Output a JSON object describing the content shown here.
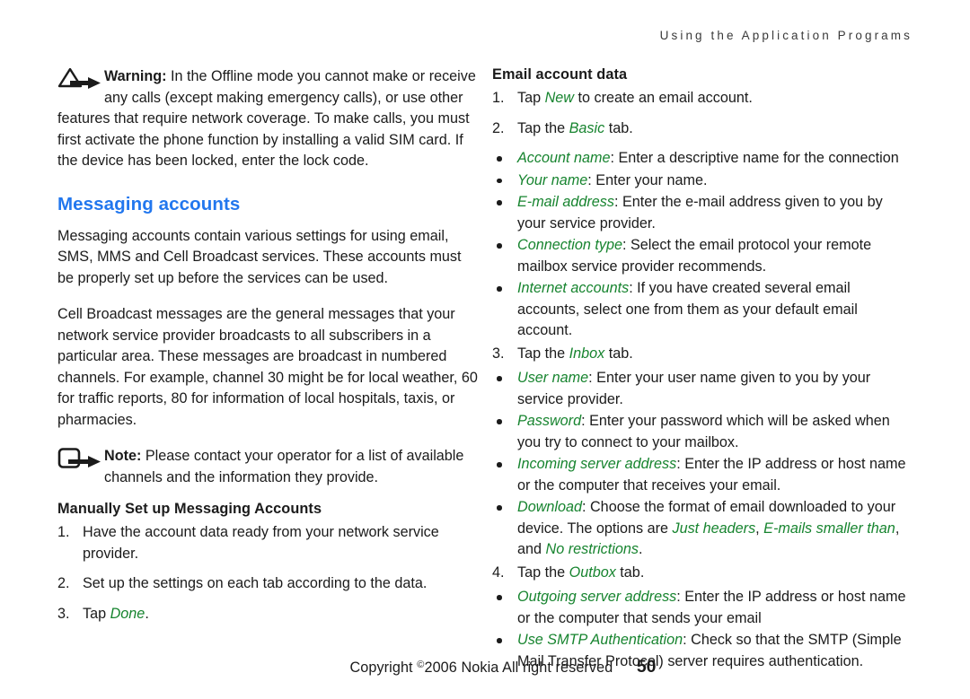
{
  "header": {
    "running_head": "Using the Application Programs"
  },
  "left_column": {
    "warning": {
      "icon": "warning-triangle-arrow-icon",
      "label": "Warning:",
      "text": " In the Offline mode you cannot make or receive any calls (except making emergency calls), or use other features that require network coverage. To make calls, you must first activate the phone function by installing a valid SIM card. If the device has been locked, enter the lock code."
    },
    "section_title": "Messaging accounts",
    "paragraph_1": "Messaging accounts contain various settings for using email, SMS, MMS and Cell Broadcast services. These accounts must be properly set up before the services can be used.",
    "paragraph_2": "Cell Broadcast messages are the general messages that your network service provider broadcasts to all subscribers in a particular area. These messages are broadcast in numbered channels. For example, channel 30 might be for local weather, 60 for traffic reports, 80 for information of local hospitals, taxis, or pharmacies.",
    "note": {
      "icon": "note-rounded-square-arrow-icon",
      "label": "Note:",
      "text": " Please contact your operator for a list of available channels and the information they provide."
    },
    "sub_title": "Manually Set up Messaging Accounts",
    "steps": [
      {
        "marker": "1.",
        "text": "Have the account data ready from your network service provider."
      },
      {
        "marker": "2.",
        "text": "Set up the settings on each tab according to the data."
      },
      {
        "marker": "3.",
        "pre": "Tap ",
        "term": "Done",
        "post": "."
      }
    ]
  },
  "right_column": {
    "sub_title": "Email account data",
    "step_1": {
      "marker": "1.",
      "pre": "Tap ",
      "term": "New",
      "post": " to create an email account."
    },
    "step_2": {
      "marker": "2.",
      "pre": "Tap the ",
      "term": "Basic",
      "post": " tab."
    },
    "basic_bullets": [
      {
        "term": "Account name",
        "text": ": Enter a descriptive name for the connection"
      },
      {
        "term": "Your name",
        "text": ": Enter your name."
      },
      {
        "term": "E-mail address",
        "text": ": Enter the e-mail address given to you by your service provider."
      },
      {
        "term": "Connection type",
        "text": ": Select the email protocol your remote mailbox service provider recommends."
      },
      {
        "term": "Internet accounts",
        "text": ": If you have created several email accounts, select one from them as your default email account."
      }
    ],
    "step_3": {
      "marker": "3.",
      "pre": "Tap the ",
      "term": "Inbox",
      "post": " tab."
    },
    "inbox_bullets": [
      {
        "term": "User name",
        "text": ": Enter your user name given to you by your service provider."
      },
      {
        "term": "Password",
        "text": ": Enter your password which will be asked when you try to connect to your mailbox."
      },
      {
        "term": "Incoming server address",
        "text": ": Enter the IP address or host name or the computer that receives your email."
      }
    ],
    "download_bullet": {
      "term": "Download",
      "text_1": ": Choose the format of email downloaded to your device. The options are ",
      "option_1": "Just headers",
      "sep_1": ", ",
      "option_2": "E-mails smaller than",
      "sep_2": ", and ",
      "option_3": "No restrictions",
      "text_2": "."
    },
    "step_4": {
      "marker": "4.",
      "pre": "Tap the ",
      "term": "Outbox",
      "post": " tab."
    },
    "outbox_bullets": [
      {
        "term": "Outgoing server address",
        "text": ": Enter the IP address or host name or the computer that sends your email"
      },
      {
        "term": "Use SMTP Authentication",
        "text": ": Check so that the SMTP (Simple Mail Transfer Protocol) server requires authentication."
      }
    ]
  },
  "footer": {
    "copyright_pre": "Copyright ",
    "copyright_symbol": "©",
    "copyright_post": "2006 Nokia All right reserved",
    "page_number": "50"
  },
  "colors": {
    "heading_blue": "#2277ee",
    "term_green": "#17842f",
    "body_black": "#1b1b1b"
  }
}
